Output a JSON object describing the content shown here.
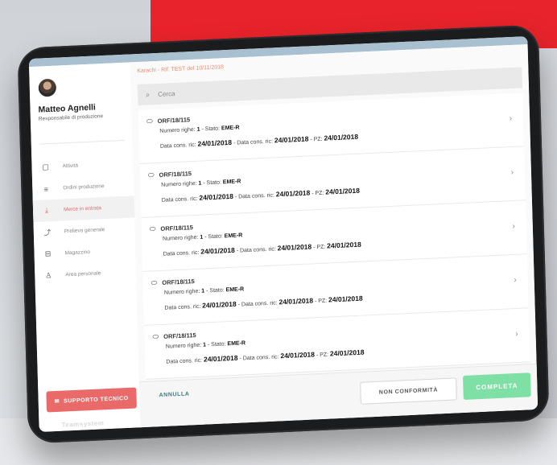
{
  "user": {
    "name": "Matteo Agnelli",
    "role": "Responsabile di produzione"
  },
  "nav": [
    {
      "label": "Attività",
      "icon": "clipboard-icon",
      "glyph": "▢",
      "active": false
    },
    {
      "label": "Ordini produzione",
      "icon": "list-icon",
      "glyph": "≡",
      "active": false
    },
    {
      "label": "Merce in entrata",
      "icon": "download-icon",
      "glyph": "⤓",
      "active": true
    },
    {
      "label": "Prelievo generale",
      "icon": "upload-icon",
      "glyph": "⤴",
      "active": false
    },
    {
      "label": "Magazzino",
      "icon": "archive-icon",
      "glyph": "⊟",
      "active": false
    },
    {
      "label": "Area personale",
      "icon": "person-icon",
      "glyph": "♙",
      "active": false
    }
  ],
  "support_label": "SUPPORTO TECNICO",
  "brand": "Teamsystem",
  "breadcrumb": "Karachi - Rif: TEST del 10/11/2018",
  "search": {
    "placeholder": "Cerca"
  },
  "orders": [
    {
      "code": "ORF/18/115",
      "rows_label": "Numero righe:",
      "rows": "1",
      "state_label": "- Stato:",
      "state": "EME-R",
      "date_label": "Data cons. ric:",
      "date": "24/01/2018",
      "date2_label": "- Data cons. ric:",
      "date2": "24/01/2018",
      "pz_label": "- PZ:",
      "pz": "24/01/2018"
    },
    {
      "code": "ORF/18/115",
      "rows_label": "Numero righe:",
      "rows": "1",
      "state_label": "- Stato:",
      "state": "EME-R",
      "date_label": "Data cons. ric:",
      "date": "24/01/2018",
      "date2_label": "- Data cons. ric:",
      "date2": "24/01/2018",
      "pz_label": "- PZ:",
      "pz": "24/01/2018"
    },
    {
      "code": "ORF/18/115",
      "rows_label": "Numero righe:",
      "rows": "1",
      "state_label": "- Stato:",
      "state": "EME-R",
      "date_label": "Data cons. ric:",
      "date": "24/01/2018",
      "date2_label": "- Data cons. ric:",
      "date2": "24/01/2018",
      "pz_label": "- PZ:",
      "pz": "24/01/2018"
    },
    {
      "code": "ORF/18/115",
      "rows_label": "Numero righe:",
      "rows": "1",
      "state_label": "- Stato:",
      "state": "EME-R",
      "date_label": "Data cons. ric:",
      "date": "24/01/2018",
      "date2_label": "- Data cons. ric:",
      "date2": "24/01/2018",
      "pz_label": "- PZ:",
      "pz": "24/01/2018"
    },
    {
      "code": "ORF/18/115",
      "rows_label": "Numero righe:",
      "rows": "1",
      "state_label": "- Stato:",
      "state": "EME-R",
      "date_label": "Data cons. ric:",
      "date": "24/01/2018",
      "date2_label": "- Data cons. ric:",
      "date2": "24/01/2018",
      "pz_label": "- PZ:",
      "pz": "24/01/2018"
    }
  ],
  "footer": {
    "cancel": "ANNULLA",
    "non_conformity": "NON CONFORMITÀ",
    "complete": "COMPLETA"
  },
  "colors": {
    "accent_red": "#e8232b",
    "support": "#ea6a6a",
    "complete": "#7ee0a4",
    "breadcrumb": "#ee8a6a"
  }
}
